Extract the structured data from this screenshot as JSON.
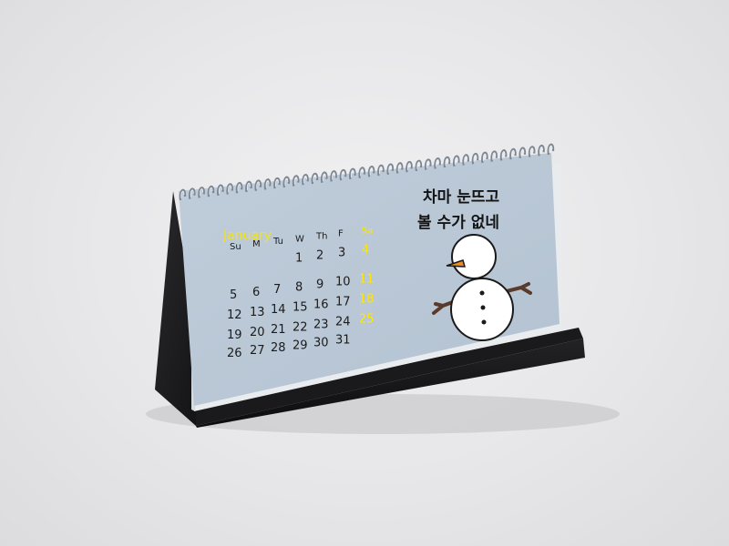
{
  "calendar": {
    "month": "January",
    "weekdays": [
      "Su",
      "M",
      "Tu",
      "W",
      "Th",
      "F",
      "Sa"
    ],
    "weeks": [
      [
        "",
        "",
        "",
        "1",
        "2",
        "3",
        "4"
      ],
      [
        "5",
        "6",
        "7",
        "8",
        "9",
        "10",
        "11"
      ],
      [
        "12",
        "13",
        "14",
        "15",
        "16",
        "17",
        "18"
      ],
      [
        "19",
        "20",
        "21",
        "22",
        "23",
        "24",
        "25"
      ],
      [
        "26",
        "27",
        "28",
        "29",
        "30",
        "31",
        ""
      ]
    ],
    "poem_lines": [
      "차마  눈뜨고",
      "볼  수가  없네"
    ]
  },
  "colors": {
    "page": "#b9c7d5",
    "stand": "#1c1c1e",
    "saturday": "#ffe600",
    "text": "#1b1b1b",
    "snowman_nose": "#f08a1c",
    "snowman_arm": "#5a3a2a"
  },
  "illustration": {
    "subject": "snowman-icon"
  }
}
